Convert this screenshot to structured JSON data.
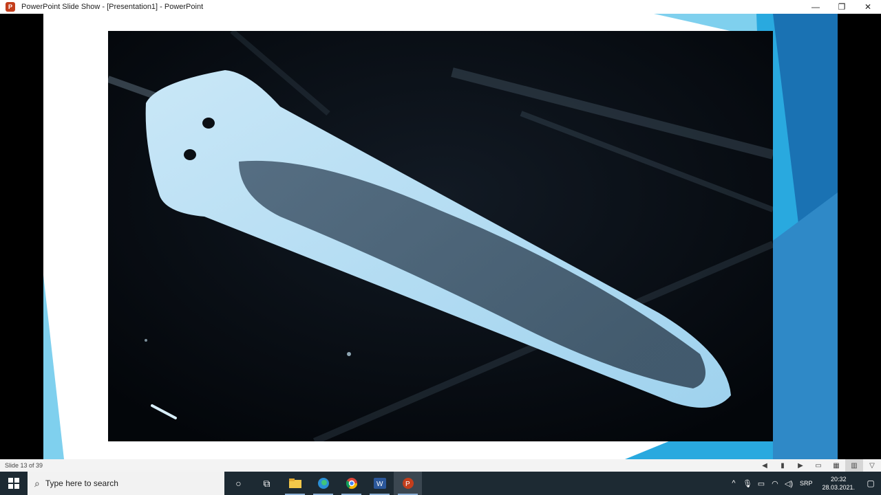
{
  "titlebar": {
    "app_badge": "P",
    "title": "PowerPoint Slide Show - [Presentation1] - PowerPoint",
    "minimize": "—",
    "restore": "❐",
    "close": "✕"
  },
  "slide": {
    "accent_colors": [
      "#7fd0ee",
      "#29a9df",
      "#1a72b3",
      "#2f89c7"
    ]
  },
  "statusbar": {
    "slide_counter": "Slide 13 of 39",
    "icons": [
      "prev-slide-icon",
      "pause-icon",
      "next-slide-icon",
      "normal-view-icon",
      "slide-sorter-icon",
      "reading-view-icon",
      "slideshow-icon"
    ]
  },
  "taskbar": {
    "search_placeholder": "Type here to search",
    "apps": [
      "cortana",
      "task-view",
      "file-explorer",
      "edge",
      "chrome",
      "word",
      "powerpoint"
    ],
    "tray": {
      "language": "SRP",
      "time": "20:32",
      "date": "28.03.2021."
    }
  }
}
